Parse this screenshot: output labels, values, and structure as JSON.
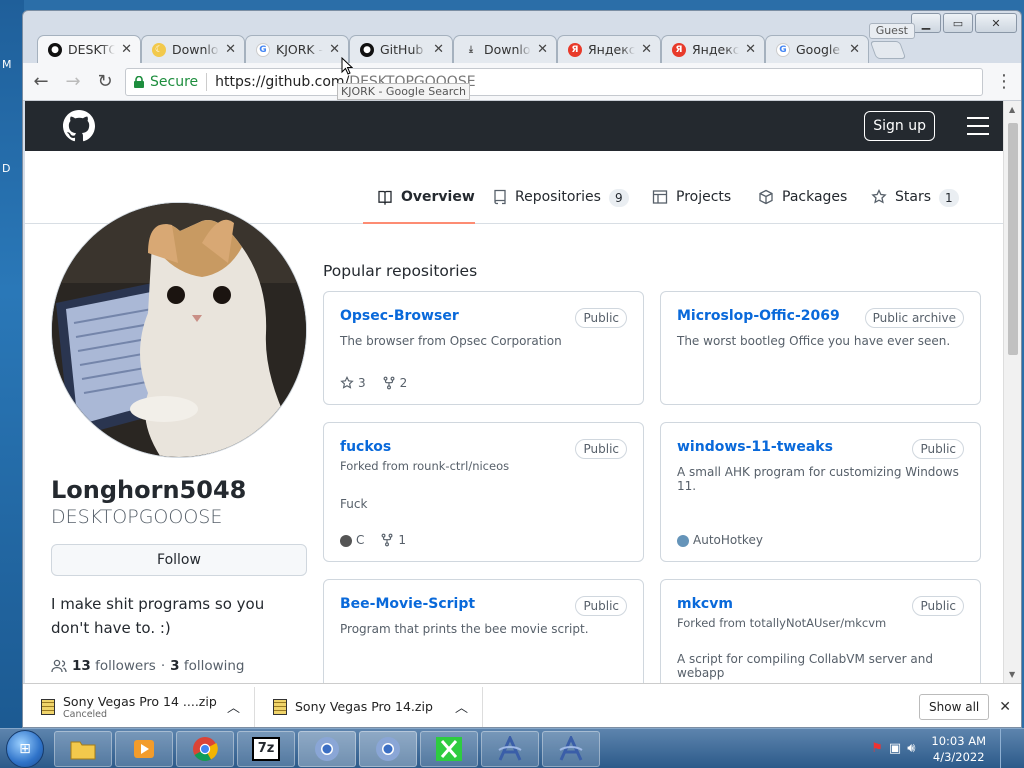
{
  "desktop": {
    "glyphs": [
      "M",
      "D"
    ]
  },
  "window": {
    "guest_label": "Guest"
  },
  "tabs": [
    {
      "title": "DESKTOPGOOOSE",
      "fav": "github-icon",
      "active": true
    },
    {
      "title": "Downloads",
      "fav": "download-moon-icon",
      "active": false
    },
    {
      "title": "KJORK - Google Search",
      "fav": "google-icon",
      "active": false
    },
    {
      "title": "GitHub",
      "fav": "github-icon",
      "active": false
    },
    {
      "title": "Downloads",
      "fav": "download-icon",
      "active": false
    },
    {
      "title": "Яндекс",
      "fav": "yandex-icon",
      "active": false
    },
    {
      "title": "Яндекс",
      "fav": "yandex-icon",
      "active": false
    },
    {
      "title": "Google",
      "fav": "google-icon",
      "active": false
    }
  ],
  "toolbar": {
    "secure_label": "Secure",
    "url_host": "https://github.com/",
    "url_path": "DESKTOPGOOOSE"
  },
  "tooltip": "KJORK - Google Search",
  "gh": {
    "signup": "Sign up"
  },
  "nav": [
    {
      "label": "Overview",
      "count": "",
      "icon": "book-icon",
      "selected": true
    },
    {
      "label": "Repositories",
      "count": "9",
      "icon": "repo-icon",
      "selected": false
    },
    {
      "label": "Projects",
      "count": "",
      "icon": "table-icon",
      "selected": false
    },
    {
      "label": "Packages",
      "count": "",
      "icon": "package-icon",
      "selected": false
    },
    {
      "label": "Stars",
      "count": "1",
      "icon": "star-icon",
      "selected": false
    }
  ],
  "profile": {
    "name": "Longhorn5048",
    "login": "DESKTOPGOOOSE",
    "follow_label": "Follow",
    "bio": "I make shit programs so you don't have to. :)",
    "followers": "13",
    "followers_label": "followers",
    "following": "3",
    "following_label": "following"
  },
  "popular_title": "Popular repositories",
  "repos": [
    {
      "name": "Opsec-Browser",
      "badge": "Public",
      "forked": "",
      "desc": "The browser from Opsec Corporation",
      "lang": "",
      "lang_color": "",
      "stars": "3",
      "forks": "2"
    },
    {
      "name": "Microslop-Offic-2069",
      "badge": "Public archive",
      "forked": "",
      "desc": "The worst bootleg Office you have ever seen.",
      "lang": "",
      "lang_color": "",
      "stars": "",
      "forks": ""
    },
    {
      "name": "fuckos",
      "badge": "Public",
      "forked": "Forked from rounk-ctrl/niceos",
      "desc": "Fuck",
      "lang": "C",
      "lang_color": "#555555",
      "stars": "",
      "forks": "1"
    },
    {
      "name": "windows-11-tweaks",
      "badge": "Public",
      "forked": "",
      "desc": "A small AHK program for customizing Windows 11.",
      "lang": "AutoHotkey",
      "lang_color": "#6594b9",
      "stars": "",
      "forks": ""
    },
    {
      "name": "Bee-Movie-Script",
      "badge": "Public",
      "forked": "",
      "desc": "Program that prints the bee movie script.",
      "lang": "",
      "lang_color": "",
      "stars": "",
      "forks": ""
    },
    {
      "name": "mkcvm",
      "badge": "Public",
      "forked": "Forked from totallyNotAUser/mkcvm",
      "desc": "A script for compiling CollabVM server and webapp",
      "lang": "",
      "lang_color": "",
      "stars": "",
      "forks": ""
    }
  ],
  "downloads": [
    {
      "name": "Sony Vegas Pro 14 ....zip",
      "status": "Canceled"
    },
    {
      "name": "Sony Vegas Pro 14.zip",
      "status": ""
    }
  ],
  "shelf": {
    "show_all": "Show all"
  },
  "taskbar": {
    "time": "10:03 AM",
    "date": "4/3/2022"
  }
}
